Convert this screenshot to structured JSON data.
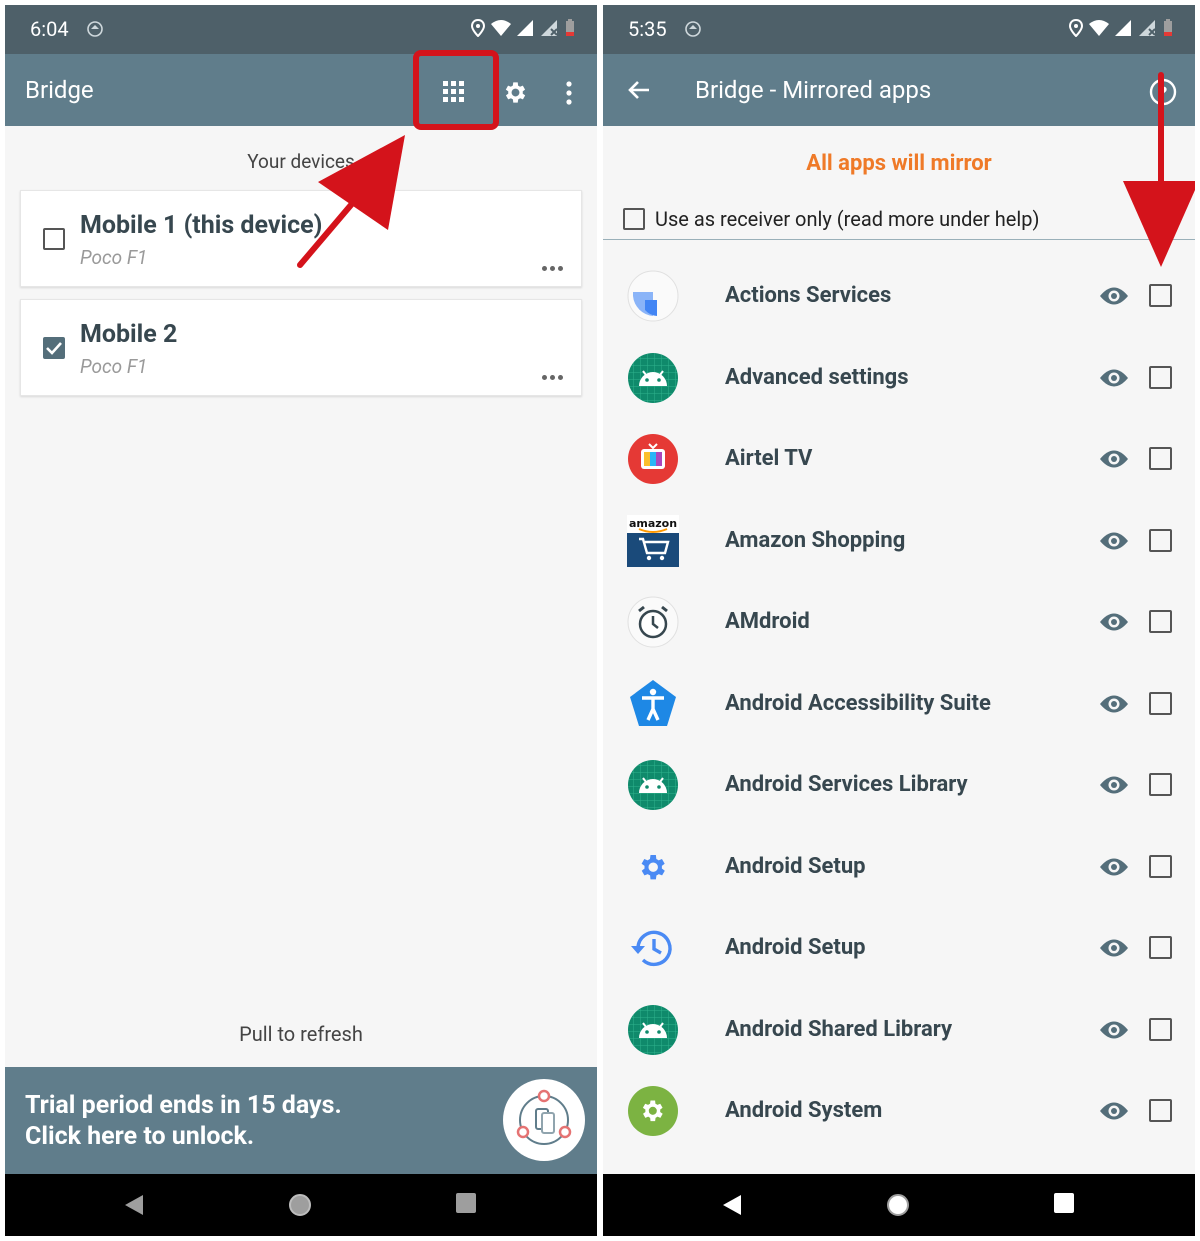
{
  "left": {
    "status_time": "6:04",
    "title": "Bridge",
    "section_label": "Your devices",
    "devices": [
      {
        "name": "Mobile 1 (this device)",
        "model": "Poco F1",
        "checked": false
      },
      {
        "name": "Mobile 2",
        "model": "Poco F1",
        "checked": true
      }
    ],
    "pull_text": "Pull to refresh",
    "trial_line1": "Trial period ends in 15 days.",
    "trial_line2": "Click here to unlock."
  },
  "right": {
    "status_time": "5:35",
    "title": "Bridge - Mirrored apps",
    "mirror_status": "All apps will mirror",
    "receiver_label": "Use as receiver only (read more under help)",
    "apps": [
      {
        "name": "Actions Services",
        "icon": "actions-services-icon"
      },
      {
        "name": "Advanced settings",
        "icon": "android-robot-icon"
      },
      {
        "name": "Airtel TV",
        "icon": "airtel-tv-icon"
      },
      {
        "name": "Amazon Shopping",
        "icon": "amazon-shopping-icon"
      },
      {
        "name": "AMdroid",
        "icon": "alarm-clock-icon"
      },
      {
        "name": "Android Accessibility Suite",
        "icon": "accessibility-icon"
      },
      {
        "name": "Android Services Library",
        "icon": "android-robot-icon"
      },
      {
        "name": "Android Setup",
        "icon": "gear-icon"
      },
      {
        "name": "Android Setup",
        "icon": "history-icon"
      },
      {
        "name": "Android Shared Library",
        "icon": "android-robot-icon"
      },
      {
        "name": "Android System",
        "icon": "android-system-gear-icon"
      }
    ],
    "amazon_word": "amazon"
  },
  "colors": {
    "status_bar": "#4e6069",
    "app_bar": "#607d8b",
    "accent_orange": "#ef7a28",
    "annotation_red": "#d4131b"
  }
}
